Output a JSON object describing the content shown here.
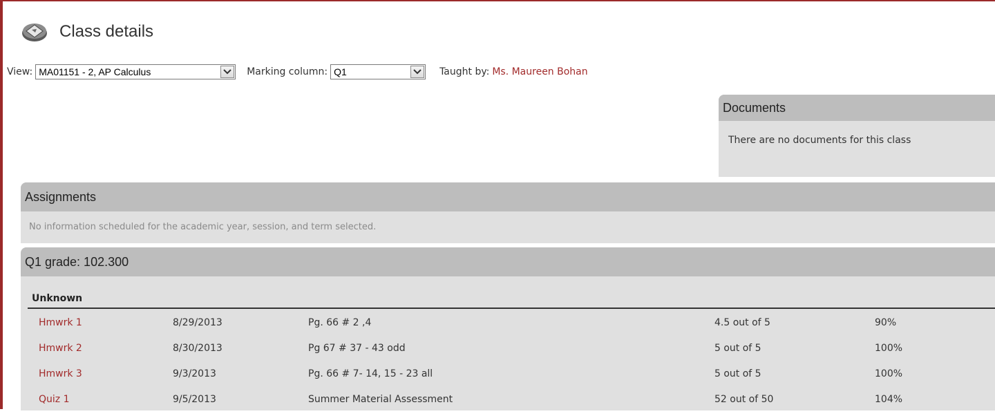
{
  "page": {
    "title": "Class details"
  },
  "filters": {
    "view_label": "View:",
    "view_value": "MA01151 - 2, AP Calculus",
    "marking_label": "Marking column:",
    "marking_value": "Q1",
    "taught_label": "Taught by:",
    "teacher_name": "Ms. Maureen Bohan"
  },
  "documents": {
    "header": "Documents",
    "empty_text": "There are no documents for this class"
  },
  "assignments": {
    "header": "Assignments",
    "empty_text": "No information scheduled for the academic year, session, and term selected."
  },
  "grades": {
    "header": "Q1 grade: 102.300",
    "group_label": "Unknown",
    "rows": [
      {
        "name": "Hmwrk 1",
        "date": "8/29/2013",
        "description": "Pg. 66 # 2 ,4",
        "score": "4.5 out of 5",
        "percent": "90%"
      },
      {
        "name": "Hmwrk 2",
        "date": "8/30/2013",
        "description": "Pg 67 # 37 - 43 odd",
        "score": "5 out of 5",
        "percent": "100%"
      },
      {
        "name": "Hmwrk 3",
        "date": "9/3/2013",
        "description": "Pg. 66 # 7- 14, 15 - 23 all",
        "score": "5 out of 5",
        "percent": "100%"
      },
      {
        "name": "Quiz 1",
        "date": "9/5/2013",
        "description": "Summer Material Assessment",
        "score": "52 out of 50",
        "percent": "104%"
      }
    ]
  },
  "colors": {
    "accent": "#9b2a2a",
    "link": "#a22b2b",
    "panel_bg": "#e0e0e0",
    "panel_header_bg": "#bdbdbd"
  },
  "icons": {
    "title_icon": "class-details-icon",
    "dropdown_icon": "chevron-down-icon"
  }
}
